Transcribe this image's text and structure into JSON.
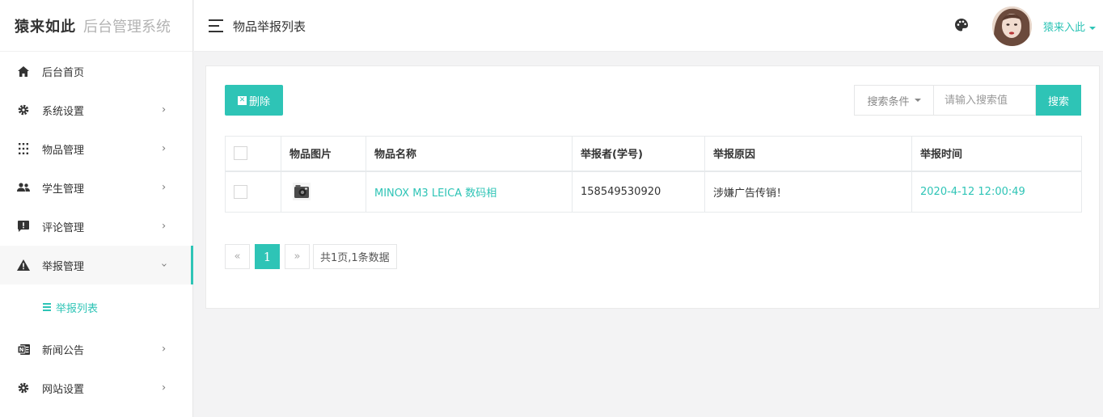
{
  "brand": {
    "logo": "猿来如此",
    "subtitle": "后台管理系统"
  },
  "header": {
    "page_title": "物品举报列表",
    "user_name": "猿来入此"
  },
  "sidebar": {
    "items": [
      {
        "label": "后台首页",
        "icon": "home-icon",
        "has_children": false
      },
      {
        "label": "系统设置",
        "icon": "gear-icon",
        "has_children": true
      },
      {
        "label": "物品管理",
        "icon": "grid-icon",
        "has_children": true
      },
      {
        "label": "学生管理",
        "icon": "users-icon",
        "has_children": true
      },
      {
        "label": "评论管理",
        "icon": "comment-alert-icon",
        "has_children": true
      },
      {
        "label": "举报管理",
        "icon": "warning-icon",
        "has_children": true,
        "expanded": true
      },
      {
        "label": "新闻公告",
        "icon": "news-icon",
        "has_children": true
      },
      {
        "label": "网站设置",
        "icon": "gear-icon",
        "has_children": true
      }
    ],
    "sub_item": "举报列表"
  },
  "toolbar": {
    "delete_label": "删除",
    "search_condition_label": "搜索条件",
    "search_placeholder": "请输入搜索值",
    "search_button": "搜索"
  },
  "table": {
    "columns": [
      "物品图片",
      "物品名称",
      "举报者(学号)",
      "举报原因",
      "举报时间"
    ],
    "rows": [
      {
        "name": "MINOX M3 LEICA 数码相",
        "reporter": "158549530920",
        "reason": "涉嫌广告传销！",
        "time": "2020-4-12 12:00:49"
      }
    ]
  },
  "pagination": {
    "prev": "«",
    "current": "1",
    "next": "»",
    "info": "共1页,1条数据"
  },
  "colors": {
    "accent": "#2ec4b6",
    "background": "#f3f3f4"
  }
}
